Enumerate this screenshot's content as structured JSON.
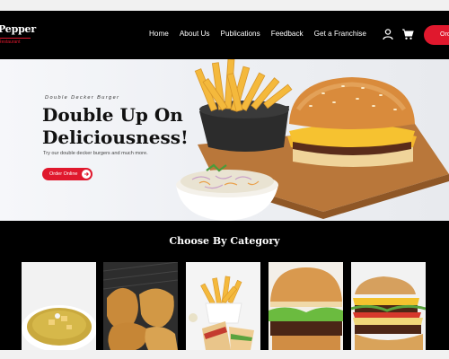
{
  "brand": {
    "name": "Pepper",
    "tagline": "Restaurant"
  },
  "nav": {
    "items": [
      "Home",
      "About Us",
      "Publications",
      "Feedback",
      "Get a Franchise"
    ],
    "user_icon": "user-icon",
    "cart_icon": "cart-icon",
    "order_label": "Order"
  },
  "hero": {
    "kicker": "Double Decker Burger",
    "title_line1": "Double Up On",
    "title_line2": "Deliciousness!",
    "description": "Try our double decker burgers and much more.",
    "cta_label": "Order Online"
  },
  "category": {
    "heading": "Choose By Category",
    "cards": [
      {
        "name": "soup"
      },
      {
        "name": "fried-chicken"
      },
      {
        "name": "fries-and-sandwich"
      },
      {
        "name": "burger"
      },
      {
        "name": "double-burger"
      }
    ]
  },
  "colors": {
    "accent": "#e0182d",
    "background": "#000000",
    "hero_bg": "#eef0f4"
  }
}
